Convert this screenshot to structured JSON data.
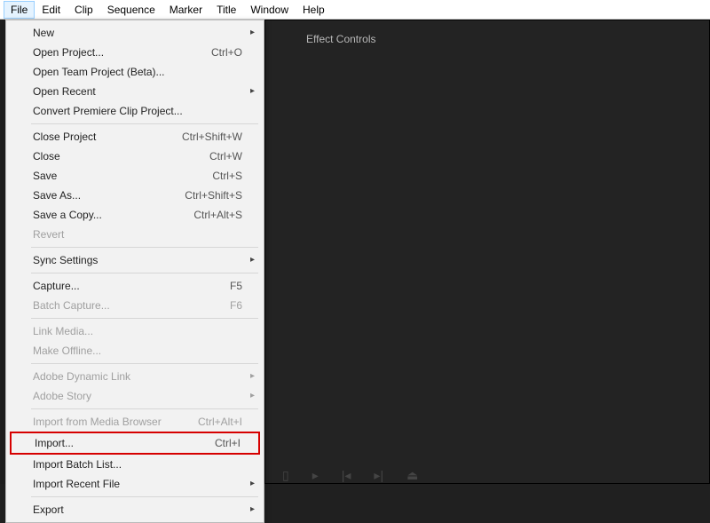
{
  "menubar": [
    "File",
    "Edit",
    "Clip",
    "Sequence",
    "Marker",
    "Title",
    "Window",
    "Help"
  ],
  "menubar_active_index": 0,
  "panel": {
    "tab": "Effect Controls"
  },
  "file_menu": {
    "groups": [
      [
        {
          "label": "New",
          "shortcut": "",
          "submenu": true,
          "disabled": false
        },
        {
          "label": "Open Project...",
          "shortcut": "Ctrl+O",
          "submenu": false,
          "disabled": false
        },
        {
          "label": "Open Team Project (Beta)...",
          "shortcut": "",
          "submenu": false,
          "disabled": false
        },
        {
          "label": "Open Recent",
          "shortcut": "",
          "submenu": true,
          "disabled": false
        },
        {
          "label": "Convert Premiere Clip Project...",
          "shortcut": "",
          "submenu": false,
          "disabled": false
        }
      ],
      [
        {
          "label": "Close Project",
          "shortcut": "Ctrl+Shift+W",
          "submenu": false,
          "disabled": false
        },
        {
          "label": "Close",
          "shortcut": "Ctrl+W",
          "submenu": false,
          "disabled": false
        },
        {
          "label": "Save",
          "shortcut": "Ctrl+S",
          "submenu": false,
          "disabled": false
        },
        {
          "label": "Save As...",
          "shortcut": "Ctrl+Shift+S",
          "submenu": false,
          "disabled": false
        },
        {
          "label": "Save a Copy...",
          "shortcut": "Ctrl+Alt+S",
          "submenu": false,
          "disabled": false
        },
        {
          "label": "Revert",
          "shortcut": "",
          "submenu": false,
          "disabled": true
        }
      ],
      [
        {
          "label": "Sync Settings",
          "shortcut": "",
          "submenu": true,
          "disabled": false
        }
      ],
      [
        {
          "label": "Capture...",
          "shortcut": "F5",
          "submenu": false,
          "disabled": false
        },
        {
          "label": "Batch Capture...",
          "shortcut": "F6",
          "submenu": false,
          "disabled": true
        }
      ],
      [
        {
          "label": "Link Media...",
          "shortcut": "",
          "submenu": false,
          "disabled": true
        },
        {
          "label": "Make Offline...",
          "shortcut": "",
          "submenu": false,
          "disabled": true
        }
      ],
      [
        {
          "label": "Adobe Dynamic Link",
          "shortcut": "",
          "submenu": true,
          "disabled": true
        },
        {
          "label": "Adobe Story",
          "shortcut": "",
          "submenu": true,
          "disabled": true
        }
      ],
      [
        {
          "label": "Import from Media Browser",
          "shortcut": "Ctrl+Alt+I",
          "submenu": false,
          "disabled": true
        },
        {
          "label": "Import...",
          "shortcut": "Ctrl+I",
          "submenu": false,
          "disabled": false,
          "highlight": true
        },
        {
          "label": "Import Batch List...",
          "shortcut": "",
          "submenu": false,
          "disabled": false
        },
        {
          "label": "Import Recent File",
          "shortcut": "",
          "submenu": true,
          "disabled": false
        }
      ],
      [
        {
          "label": "Export",
          "shortcut": "",
          "submenu": true,
          "disabled": false
        }
      ]
    ]
  }
}
